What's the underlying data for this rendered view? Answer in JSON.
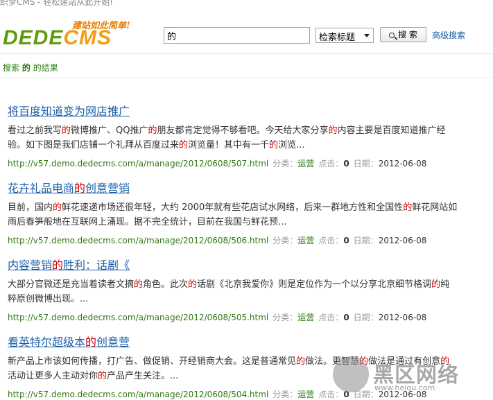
{
  "window": {
    "title": "织梦CMS - 轻松建站从此开始!"
  },
  "header": {
    "logo": {
      "tagline": "建站如此简单!",
      "text_left": "DEDE",
      "text_right": "CMS"
    },
    "search": {
      "value": "的",
      "scope_selected": "检索标题",
      "button_label": "搜 索",
      "advanced_link": "高级搜索"
    }
  },
  "breadcrumb": {
    "prefix": "搜索",
    "keyword": "的",
    "suffix": "的结果"
  },
  "highlight_color": "#cc0000",
  "meta_labels": {
    "category": "分类：",
    "clicks": "点击：",
    "date": "日期："
  },
  "results": [
    {
      "title_segments": [
        {
          "t": "将百度知道变为网店推广",
          "h": false
        }
      ],
      "desc_segments": [
        {
          "t": "看过之前我写",
          "h": false
        },
        {
          "t": "的",
          "h": true
        },
        {
          "t": "微博推广、QQ推广",
          "h": false
        },
        {
          "t": "的",
          "h": true
        },
        {
          "t": "朋友都肯定觉得不够看吧。今天给大家分享",
          "h": false
        },
        {
          "t": "的",
          "h": true
        },
        {
          "t": "内容主要是百度知道推广经验。如下图是我们店铺一个礼拜从百度过来",
          "h": false
        },
        {
          "t": "的",
          "h": true
        },
        {
          "t": "浏览量！其中有一千",
          "h": false
        },
        {
          "t": "的",
          "h": true
        },
        {
          "t": "浏览...",
          "h": false
        }
      ],
      "url": "http://v57.demo.dedecms.com/a/manage/2012/0608/507.html",
      "category": "运营",
      "clicks": "0",
      "date": "2012-06-08"
    },
    {
      "title_segments": [
        {
          "t": "花卉礼品电商",
          "h": false
        },
        {
          "t": "的",
          "h": true
        },
        {
          "t": "创意营销",
          "h": false
        }
      ],
      "desc_segments": [
        {
          "t": "目前，国内",
          "h": false
        },
        {
          "t": "的",
          "h": true
        },
        {
          "t": "鲜花速递市场还很年轻，大约 2000年就有些花店试水网络，后来一群地方性和全国性",
          "h": false
        },
        {
          "t": "的",
          "h": true
        },
        {
          "t": "鲜花网站如雨后春笋般地在互联网上涌现。据不完全统计，目前在我国与鲜花预...",
          "h": false
        }
      ],
      "url": "http://v57.demo.dedecms.com/a/manage/2012/0608/506.html",
      "category": "运营",
      "clicks": "0",
      "date": "2012-06-08"
    },
    {
      "title_segments": [
        {
          "t": "内容营销",
          "h": false
        },
        {
          "t": "的",
          "h": true
        },
        {
          "t": "胜利：话剧《",
          "h": false
        }
      ],
      "desc_segments": [
        {
          "t": "大部分官微还是充当着读者文摘",
          "h": false
        },
        {
          "t": "的",
          "h": true
        },
        {
          "t": "角色。此次",
          "h": false
        },
        {
          "t": "的",
          "h": true
        },
        {
          "t": "话剧《北京我爱你》则是定位作为一个以分享北京细节格调",
          "h": false
        },
        {
          "t": "的",
          "h": true
        },
        {
          "t": "纯粹原创微博出现。...",
          "h": false
        }
      ],
      "url": "http://v57.demo.dedecms.com/a/manage/2012/0608/505.html",
      "category": "运营",
      "clicks": "0",
      "date": "2012-06-08"
    },
    {
      "title_segments": [
        {
          "t": "看英特尔超级本",
          "h": false
        },
        {
          "t": "的",
          "h": true
        },
        {
          "t": "创意营",
          "h": false
        }
      ],
      "desc_segments": [
        {
          "t": "新产品上市该如何传播，打广告、做促销、开经销商大会。这是普通常见",
          "h": false
        },
        {
          "t": "的",
          "h": true
        },
        {
          "t": "做法。更智慧",
          "h": false
        },
        {
          "t": "的",
          "h": true
        },
        {
          "t": "做法是通过有创意",
          "h": false
        },
        {
          "t": "的",
          "h": true
        },
        {
          "t": "活动让更多人主动对你",
          "h": false
        },
        {
          "t": "的",
          "h": true
        },
        {
          "t": "产品产生关注。...",
          "h": false
        }
      ],
      "url": "http://v57.demo.dedecms.com/a/manage/2012/0608/504.html",
      "category": "运营",
      "clicks": "0",
      "date": "2012-06-08"
    }
  ],
  "watermark": {
    "text": "黑区网络",
    "sub": "www.heiqu.com"
  }
}
